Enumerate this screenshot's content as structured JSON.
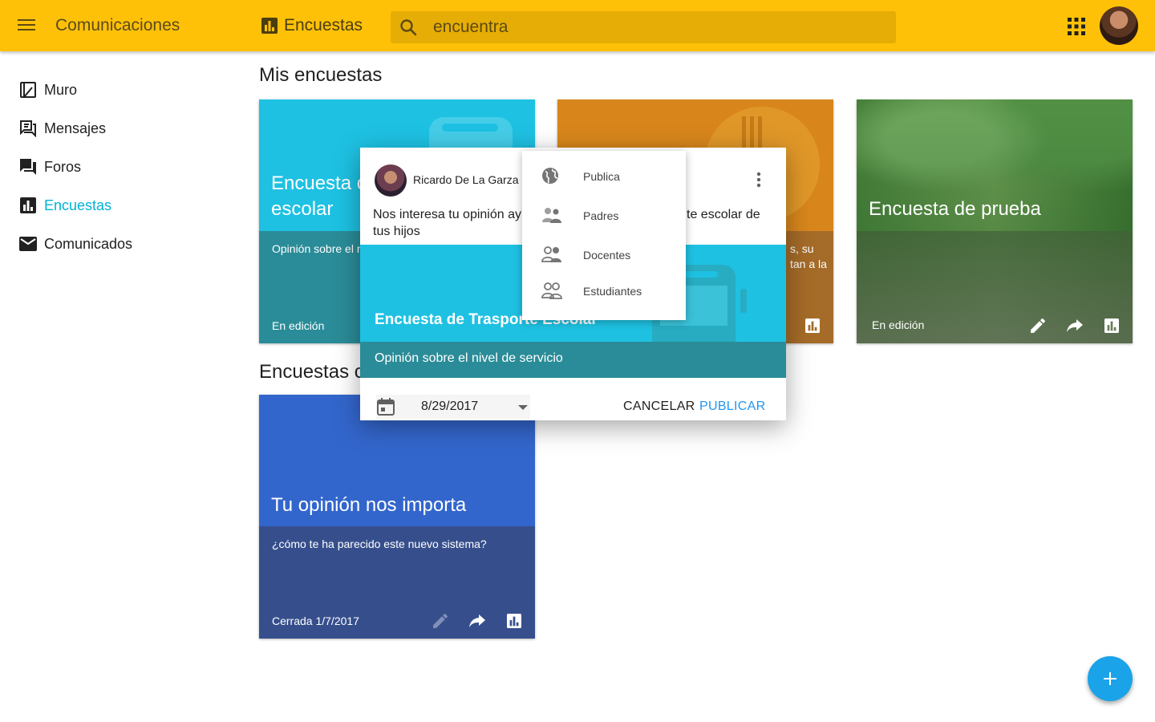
{
  "topbar": {
    "app_title": "Comunicaciones",
    "section_title": "Encuestas",
    "search_value": "encuentra"
  },
  "sidebar": {
    "items": [
      {
        "label": "Muro",
        "icon": "book-icon"
      },
      {
        "label": "Mensajes",
        "icon": "forum-icon"
      },
      {
        "label": "Foros",
        "icon": "chat-icon"
      },
      {
        "label": "Encuestas",
        "icon": "poll-icon",
        "active": true
      },
      {
        "label": "Comunicados",
        "icon": "mail-icon"
      }
    ]
  },
  "main": {
    "mis_heading": "Mis encuestas",
    "encuestas_heading": "Encuestas c",
    "cards": [
      {
        "title": "Encuesta c\nescolar",
        "description": "Opinión sobre el n",
        "status": "En edición",
        "color": "#1ec1e2"
      },
      {
        "title": "",
        "description_line1": "s, su",
        "description_line2": "tan a la",
        "status": "",
        "color": "#d8861c"
      },
      {
        "title": "Encuesta de prueba",
        "status": "En edición"
      },
      {
        "title": "Tu opinión nos importa",
        "description": "¿cómo te ha parecido este nuevo sistema?",
        "status": "Cerrada 1/7/2017",
        "color": "#3366cc"
      }
    ]
  },
  "dialog": {
    "author": "Ricardo De La Garza",
    "message": "Nos interesa tu opinión ay",
    "message_tail": "te escolar de",
    "message_line2": "tus hijos",
    "banner_title": "Encuesta de Trasporte Escolar",
    "subtitle": "Opinión sobre el nivel de servicio",
    "date": "8/29/2017",
    "cancel_label": "CANCELAR",
    "publish_label": "PUBLICAR"
  },
  "menu": {
    "items": [
      {
        "label": "Publica",
        "icon": "globe-icon"
      },
      {
        "label": "Padres",
        "icon": "parents-icon"
      },
      {
        "label": "Docentes",
        "icon": "teachers-icon"
      },
      {
        "label": "Estudiantes",
        "icon": "students-icon"
      }
    ]
  },
  "colors": {
    "topbar": "#ffc107",
    "accent": "#00b3d7",
    "fab": "#1aa3e8",
    "publish": "#2196f3"
  }
}
